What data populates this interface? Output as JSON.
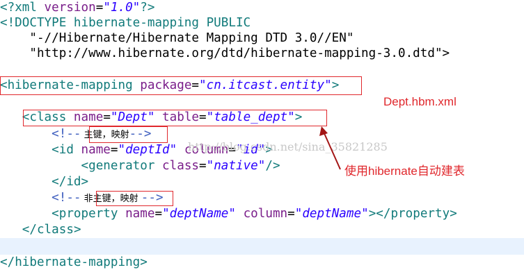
{
  "editor": {
    "lines": [
      {
        "open": "<?",
        "name": "xml",
        "attr1": " version",
        "eq1": "=",
        "val1": "\"1.0\"",
        "close": "?>"
      },
      {
        "text": "<!DOCTYPE hibernate-mapping PUBLIC"
      },
      {
        "text": "    \"-//Hibernate/Hibernate Mapping DTD 3.0//EN\""
      },
      {
        "text": "    \"http://www.hibernate.org/dtd/hibernate-mapping-3.0.dtd\">"
      },
      {
        "open": "<",
        "name": "hibernate-mapping",
        "attr1": " package",
        "eq1": "=",
        "val1": "\"cn.itcast.entity\"",
        "close": ">"
      },
      {
        "indent": "   ",
        "open": "<",
        "name": "class",
        "attr1": " name",
        "eq1": "=",
        "val1": "\"Dept\"",
        "attr2": " table",
        "eq2": "=",
        "val2": "\"table_dept\"",
        "close": ">"
      },
      {
        "indent": "       ",
        "cstart": "<!--",
        "ctext": " 主键，映射",
        "cend": "-->"
      },
      {
        "indent": "       ",
        "open": "<",
        "name": "id",
        "attr1": " name",
        "eq1": "=",
        "val1": "\"deptId\"",
        "attr2": " column",
        "eq2": "=",
        "val2": "\"id\"",
        "close": ">"
      },
      {
        "indent": "           ",
        "open": "<",
        "name": "generator",
        "attr1": " class",
        "eq1": "=",
        "val1": "\"native\"",
        "close": "/>"
      },
      {
        "indent": "       ",
        "open": "</",
        "name": "id",
        "close": ">"
      },
      {
        "indent": "       ",
        "cstart": "<!--",
        "ctext": " 非主键，映射 ",
        "cend": "-->"
      },
      {
        "indent": "       ",
        "open": "<",
        "name": "property",
        "attr1": " name",
        "eq1": "=",
        "val1": "\"deptName\"",
        "attr2": " column",
        "eq2": "=",
        "val2": "\"deptName\"",
        "close": "></",
        "name2": "property",
        "close2": ">"
      },
      {
        "indent": "   ",
        "open": "</",
        "name": "class",
        "close": ">"
      },
      {
        "open": "</",
        "name": "hibernate-mapping",
        "close": ">"
      }
    ]
  },
  "annotations": {
    "file_label": "Dept.hbm.xml",
    "auto_table_note": "使用hibernate自动建表"
  },
  "watermark": "http://blog.csdn.net/sina_35821285",
  "colors": {
    "tag": "#117a7a",
    "attr": "#7a1e8a",
    "value": "#2a00ff",
    "comment": "#3f5fbf",
    "annotation": "#e0272c",
    "current_line": "#e8f2fe"
  }
}
